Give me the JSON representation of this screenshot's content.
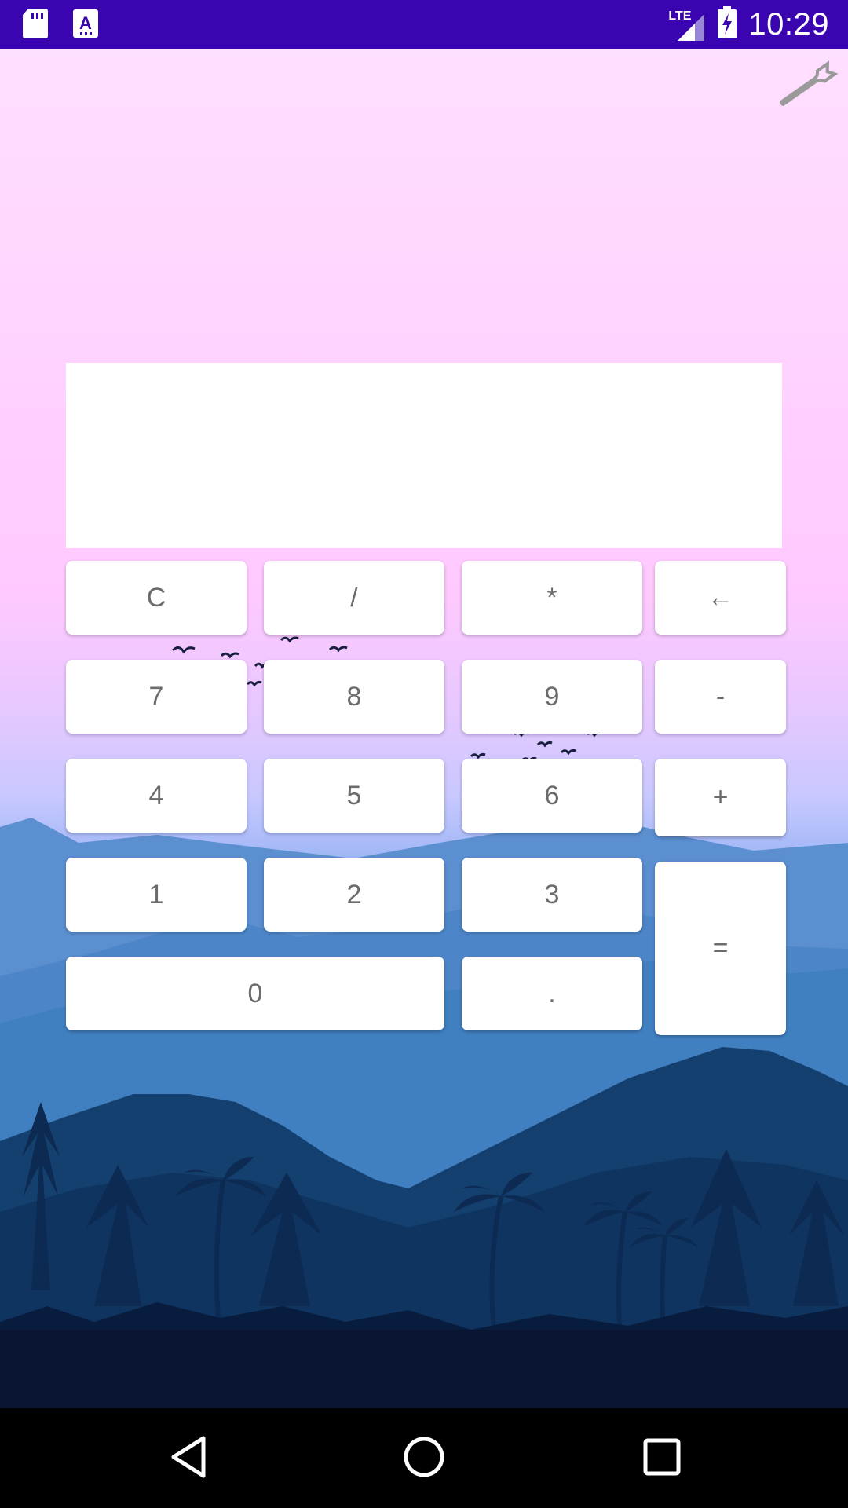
{
  "status_bar": {
    "time": "10:29",
    "network_label": "LTE",
    "left_icons": [
      "sd-card-icon",
      "font-app-icon"
    ],
    "right_icons": [
      "signal-icon",
      "battery-charging-icon"
    ],
    "background_color": "#3a04b1"
  },
  "toolbar": {
    "settings_icon": "wrench-icon"
  },
  "display": {
    "value": ""
  },
  "keypad": {
    "clear": "C",
    "divide": "/",
    "multiply": "*",
    "backspace": "←",
    "seven": "7",
    "eight": "8",
    "nine": "9",
    "minus": "-",
    "four": "4",
    "five": "5",
    "six": "6",
    "plus": "+",
    "one": "1",
    "two": "2",
    "three": "3",
    "equals": "=",
    "zero": "0",
    "decimal": "."
  },
  "nav_bar": {
    "icons": [
      "back-icon",
      "home-icon",
      "recents-icon"
    ]
  },
  "colors": {
    "accent": "#3a04b1",
    "key_text": "#6b6b6b",
    "sky_top": "#ffdfff",
    "mountain_dark": "#0a2a52"
  }
}
